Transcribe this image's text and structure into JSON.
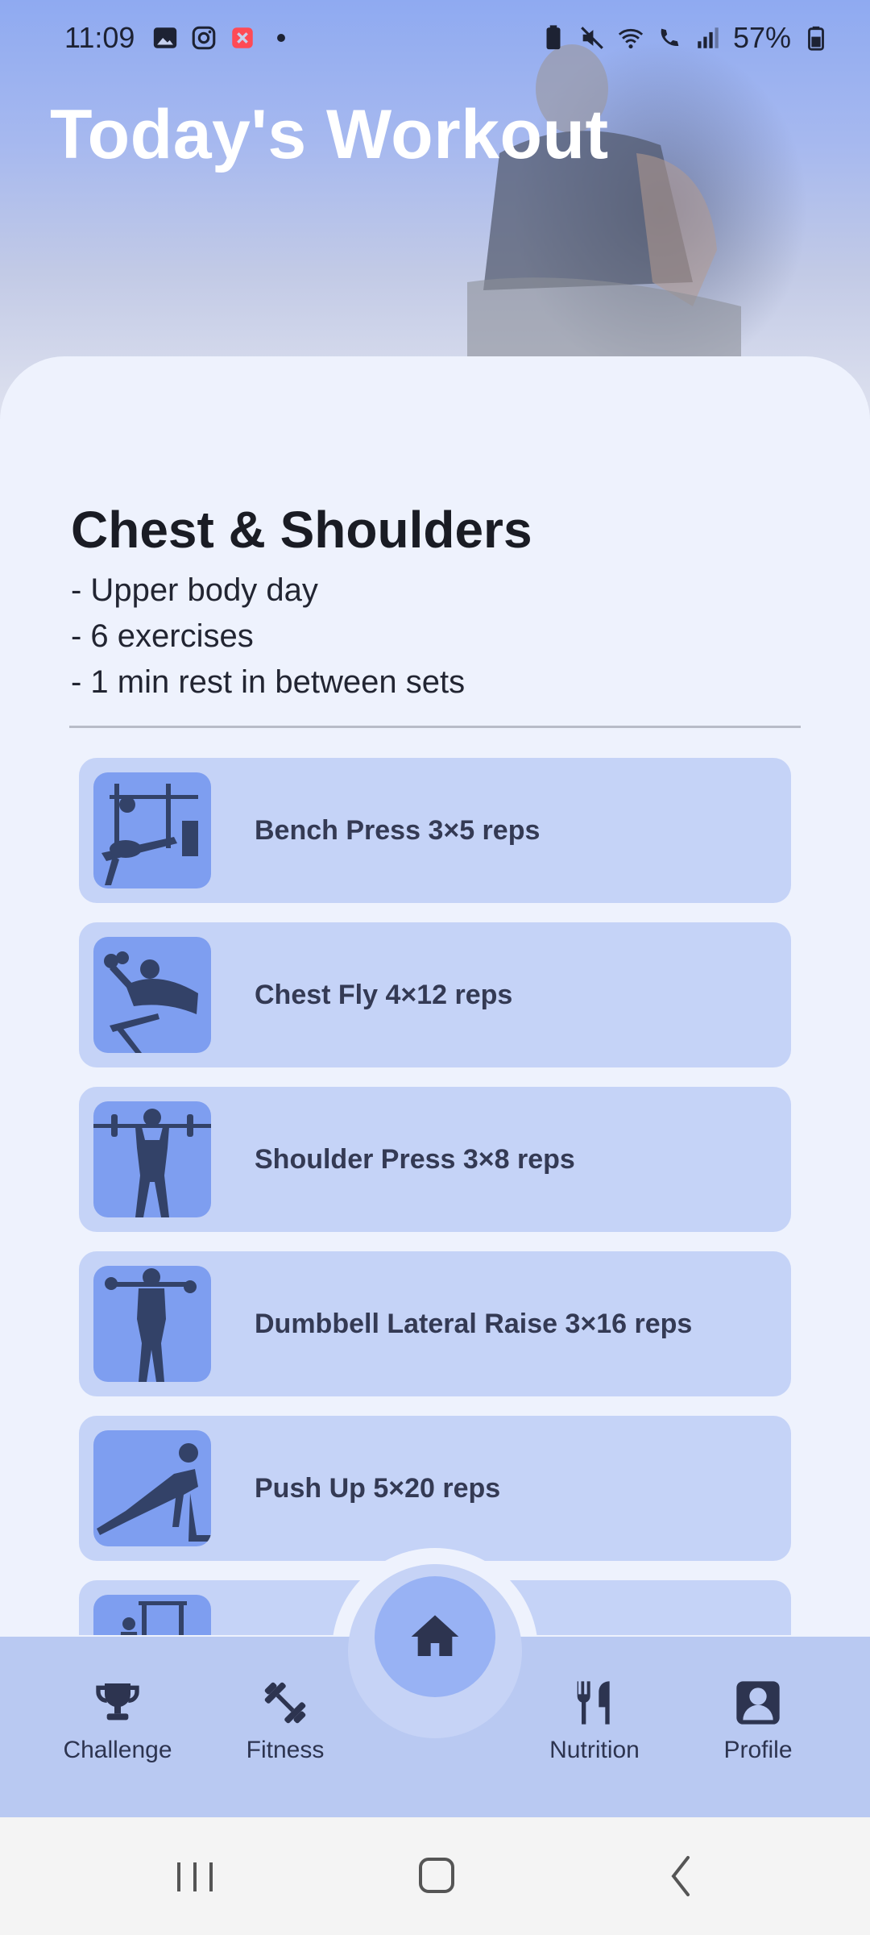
{
  "status_bar": {
    "time": "11:09",
    "battery": "57%"
  },
  "header": {
    "title": "Today's Workout"
  },
  "workout": {
    "name": "Chest & Shoulders",
    "details": [
      "- Upper body day",
      "- 6 exercises",
      "- 1 min rest in between sets"
    ]
  },
  "exercises": [
    {
      "label": "Bench Press 3×5 reps",
      "icon": "bench-press-icon"
    },
    {
      "label": "Chest Fly 4×12 reps",
      "icon": "chest-fly-icon"
    },
    {
      "label": "Shoulder Press 3×8 reps",
      "icon": "shoulder-press-icon"
    },
    {
      "label": "Dumbbell Lateral Raise 3×16 reps",
      "icon": "lateral-raise-icon"
    },
    {
      "label": "Push Up 5×20 reps",
      "icon": "push-up-icon"
    },
    {
      "label": "",
      "icon": "pull-up-icon"
    }
  ],
  "nav": {
    "challenge": "Challenge",
    "fitness": "Fitness",
    "nutrition": "Nutrition",
    "profile": "Profile",
    "home_icon": "home-icon"
  },
  "colors": {
    "card": "#c5d3f7",
    "thumb": "#7e9ef0",
    "nav_bg": "#b9c9f2",
    "accent": "#98b2f4",
    "text_dark": "#343a54"
  }
}
